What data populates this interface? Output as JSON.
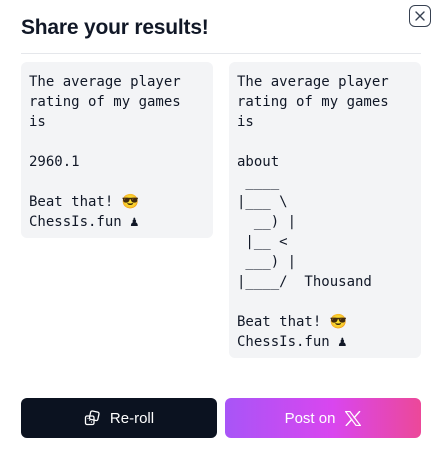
{
  "dialog": {
    "title": "Share your results!",
    "close_icon": "close-icon"
  },
  "cards": [
    {
      "text": "The average player\nrating of my games\nis\n\n2960.1\n\nBeat that! 😎\nChessIs.fun ♟"
    },
    {
      "text": "The average player\nrating of my games\nis\n\nabout\n ____\n|___ \\\n  __) |\n |__ <\n ___) |\n|____/  Thousand\n\nBeat that! 😎\nChessIs.fun ♟"
    }
  ],
  "actions": {
    "reroll_label": "Re-roll",
    "reroll_icon": "reroll-icon",
    "post_label": "Post on",
    "post_icon": "x-logo-icon"
  },
  "colors": {
    "reroll_bg": "#0b1220",
    "post_gradient_start": "#a855f7",
    "post_gradient_end": "#ec4899",
    "card_bg": "#f3f4f6"
  }
}
